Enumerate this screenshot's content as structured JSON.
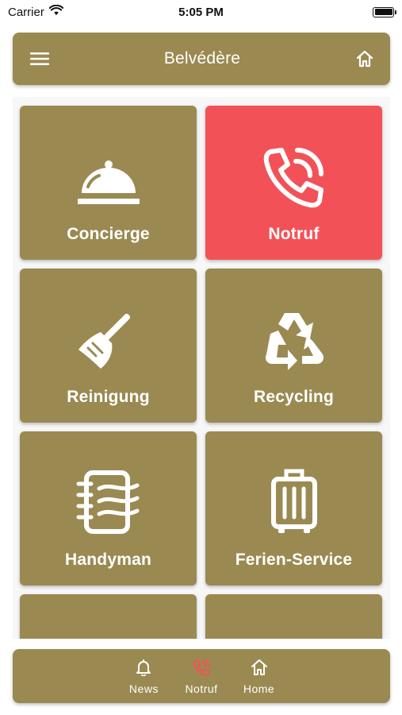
{
  "status_bar": {
    "carrier": "Carrier",
    "time": "5:05 PM"
  },
  "header": {
    "title": "Belvédère",
    "menu_icon": "hamburger-menu-icon",
    "home_icon": "home-icon"
  },
  "tiles": [
    {
      "label": "Concierge",
      "icon": "service-bell-icon"
    },
    {
      "label": "Notruf",
      "icon": "phone-ringing-icon",
      "color": "#f25257"
    },
    {
      "label": "Reinigung",
      "icon": "broom-icon"
    },
    {
      "label": "Recycling",
      "icon": "recycle-icon"
    },
    {
      "label": "Handyman",
      "icon": "notebook-icon"
    },
    {
      "label": "Ferien-Service",
      "icon": "suitcase-icon"
    }
  ],
  "bottom_nav": [
    {
      "label": "News",
      "icon": "bell-icon"
    },
    {
      "label": "Notruf",
      "icon": "phone-icon",
      "color": "#f25257"
    },
    {
      "label": "Home",
      "icon": "home-icon"
    }
  ],
  "colors": {
    "primary": "#9a8a52",
    "alert": "#f25257",
    "panel": "#f7f7f7"
  }
}
